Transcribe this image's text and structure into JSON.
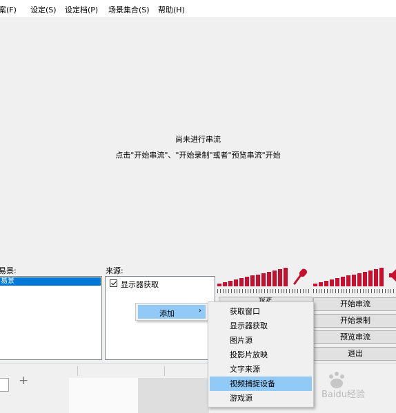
{
  "menubar": {
    "items": [
      "档案(F)",
      "设定(S)",
      "设定档(P)",
      "场景集合(S)",
      "帮助(H)"
    ],
    "visible_items": [
      "案(F)",
      "设定(S)",
      "设定档(P)",
      "场景集合(S)",
      "帮助(H)"
    ]
  },
  "preview": {
    "line1": "尚未进行串流",
    "line2": "点击\"开始串流\"、\"开始录制\"或者\"预览串流\"开始"
  },
  "scenes": {
    "label": "场景:",
    "visible_label": "易景:",
    "selected_item": "场景",
    "visible_selected": "易景"
  },
  "sources": {
    "label": "来源:",
    "items": [
      {
        "label": "显示器获取",
        "checked": true
      }
    ]
  },
  "buttons": {
    "settings": "设定",
    "start_stream": "开始串流",
    "start_record": "开始录制",
    "preview_stream": "预览串流",
    "exit": "退出"
  },
  "context_menu": {
    "add": "添加",
    "submenu_arrow": "›",
    "submenu": [
      "获取窗口",
      "显示器获取",
      "图片源",
      "投影片放映",
      "文字来源",
      "视频捕捉设备",
      "游戏源"
    ],
    "highlighted_index": 5
  },
  "watermark": {
    "text": "Baidu经验"
  },
  "colors": {
    "meter": "#c8102e",
    "selection": "#0078d7",
    "menu_highlight": "#91c9f7"
  }
}
